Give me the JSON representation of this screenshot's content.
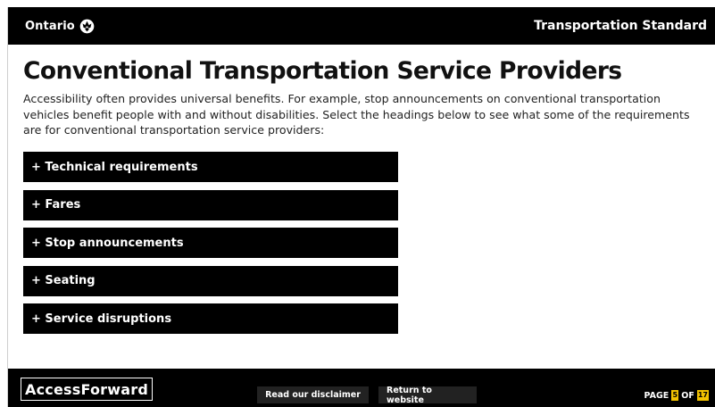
{
  "header": {
    "brand": "Ontario",
    "brand_icon": "trillium-icon",
    "standard_title": "Transportation Standard"
  },
  "main": {
    "title": "Conventional Transportation Service Providers",
    "intro": "Accessibility often provides universal benefits. For example, stop announcements on conventional transportation vehicles benefit people with and without disabilities.  Select the headings below to see what some of the requirements are for conventional transportation service providers:"
  },
  "accordions": [
    {
      "label": "+ Technical requirements"
    },
    {
      "label": "+ Fares"
    },
    {
      "label": "+ Stop announcements"
    },
    {
      "label": "+ Seating"
    },
    {
      "label": "+ Service disruptions"
    }
  ],
  "footer": {
    "logo": "AccessForward",
    "disclaimer_label": "Read our disclaimer",
    "website_label": "Return to website",
    "page_prefix": "PAGE",
    "page_current": "5",
    "page_of": "OF",
    "page_total": "17"
  },
  "colors": {
    "bar": "#000000",
    "page_indicator": "#f2c200"
  }
}
